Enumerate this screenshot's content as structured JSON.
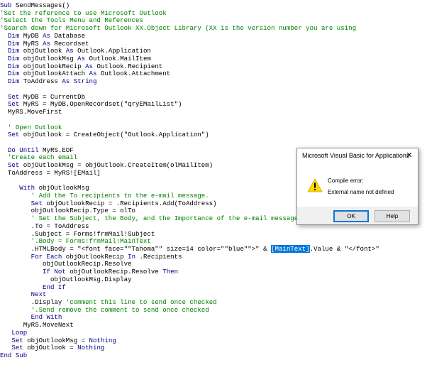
{
  "code": {
    "lines": [
      [
        {
          "k": "k",
          "t": "Sub "
        },
        {
          "k": "n",
          "t": "SendMessages()"
        }
      ],
      [
        {
          "k": "c",
          "t": "'Set the reference to use Microsoft Outlook"
        }
      ],
      [
        {
          "k": "c",
          "t": "'Select the Tools Menu and References"
        }
      ],
      [
        {
          "k": "c",
          "t": "'Search down for Microsoft Outlook XX.Object Library (XX is the version number you are using"
        }
      ],
      [
        {
          "k": "n",
          "t": "  "
        },
        {
          "k": "k",
          "t": "Dim "
        },
        {
          "k": "n",
          "t": "MyDB "
        },
        {
          "k": "k",
          "t": "As "
        },
        {
          "k": "n",
          "t": "Database"
        }
      ],
      [
        {
          "k": "n",
          "t": "  "
        },
        {
          "k": "k",
          "t": "Dim "
        },
        {
          "k": "n",
          "t": "MyRS "
        },
        {
          "k": "k",
          "t": "As "
        },
        {
          "k": "n",
          "t": "Recordset"
        }
      ],
      [
        {
          "k": "n",
          "t": "  "
        },
        {
          "k": "k",
          "t": "Dim "
        },
        {
          "k": "n",
          "t": "objOutlook "
        },
        {
          "k": "k",
          "t": "As "
        },
        {
          "k": "n",
          "t": "Outlook.Application"
        }
      ],
      [
        {
          "k": "n",
          "t": "  "
        },
        {
          "k": "k",
          "t": "Dim "
        },
        {
          "k": "n",
          "t": "objOutlookMsg "
        },
        {
          "k": "k",
          "t": "As "
        },
        {
          "k": "n",
          "t": "Outlook.MailItem"
        }
      ],
      [
        {
          "k": "n",
          "t": "  "
        },
        {
          "k": "k",
          "t": "Dim "
        },
        {
          "k": "n",
          "t": "objOutlookRecip "
        },
        {
          "k": "k",
          "t": "As "
        },
        {
          "k": "n",
          "t": "Outlook.Recipient"
        }
      ],
      [
        {
          "k": "n",
          "t": "  "
        },
        {
          "k": "k",
          "t": "Dim "
        },
        {
          "k": "n",
          "t": "objOutlookAttach "
        },
        {
          "k": "k",
          "t": "As "
        },
        {
          "k": "n",
          "t": "Outlook.Attachment"
        }
      ],
      [
        {
          "k": "n",
          "t": "  "
        },
        {
          "k": "k",
          "t": "Dim "
        },
        {
          "k": "n",
          "t": "ToAddress "
        },
        {
          "k": "k",
          "t": "As String"
        }
      ],
      [],
      [
        {
          "k": "n",
          "t": "  "
        },
        {
          "k": "k",
          "t": "Set "
        },
        {
          "k": "n",
          "t": "MyDB = CurrentDb"
        }
      ],
      [
        {
          "k": "n",
          "t": "  "
        },
        {
          "k": "k",
          "t": "Set "
        },
        {
          "k": "n",
          "t": "MyRS = MyDB.OpenRecordset(\"qryEMailList\")"
        }
      ],
      [
        {
          "k": "n",
          "t": "  MyRS.MoveFirst"
        }
      ],
      [],
      [
        {
          "k": "c",
          "t": "  ' Open Outlook"
        }
      ],
      [
        {
          "k": "n",
          "t": "  "
        },
        {
          "k": "k",
          "t": "Set "
        },
        {
          "k": "n",
          "t": "objOutlook = CreateObject(\"Outlook.Application\")"
        }
      ],
      [],
      [
        {
          "k": "n",
          "t": "  "
        },
        {
          "k": "k",
          "t": "Do Until "
        },
        {
          "k": "n",
          "t": "MyRS.EOF"
        }
      ],
      [
        {
          "k": "c",
          "t": "  'Create each email"
        }
      ],
      [
        {
          "k": "n",
          "t": "  "
        },
        {
          "k": "k",
          "t": "Set "
        },
        {
          "k": "n",
          "t": "objOutlookMsg = objOutlook.CreateItem(olMailItem)"
        }
      ],
      [
        {
          "k": "n",
          "t": "  ToAddress = MyRS![EMail]"
        }
      ],
      [],
      [
        {
          "k": "n",
          "t": "     "
        },
        {
          "k": "k",
          "t": "With "
        },
        {
          "k": "n",
          "t": "objOutlookMsg"
        }
      ],
      [
        {
          "k": "c",
          "t": "        ' Add the To recipients to the e-mail message."
        }
      ],
      [
        {
          "k": "n",
          "t": "        "
        },
        {
          "k": "k",
          "t": "Set "
        },
        {
          "k": "n",
          "t": "objOutlookRecip = .Recipients.Add(ToAddress)"
        }
      ],
      [
        {
          "k": "n",
          "t": "        objOutlookRecip.Type = olTo"
        }
      ],
      [
        {
          "k": "c",
          "t": "        ' Set the Subject, the Body, and the Importance of the e-mail message."
        }
      ],
      [
        {
          "k": "n",
          "t": "        .To = ToAddress"
        }
      ],
      [
        {
          "k": "n",
          "t": "        .Subject = Forms!frmMail!Subject"
        }
      ],
      [
        {
          "k": "c",
          "t": "        '.Body = Forms!frmMail!MainText"
        }
      ],
      [
        {
          "k": "n",
          "t": "        .HTMLBody = \"<font face=\"\"Tahoma\"\" size=14 color=\"\"blue\"\">\" & "
        },
        {
          "k": "h",
          "t": "[MainText]"
        },
        {
          "k": "n",
          "t": ".Value & \"</font>\""
        }
      ],
      [
        {
          "k": "n",
          "t": "        "
        },
        {
          "k": "k",
          "t": "For Each "
        },
        {
          "k": "n",
          "t": "objOutlookRecip "
        },
        {
          "k": "k",
          "t": "In "
        },
        {
          "k": "n",
          "t": ".Recipients"
        }
      ],
      [
        {
          "k": "n",
          "t": "           objOutlookRecip.Resolve"
        }
      ],
      [
        {
          "k": "n",
          "t": "           "
        },
        {
          "k": "k",
          "t": "If Not "
        },
        {
          "k": "n",
          "t": "objOutlookRecip.Resolve "
        },
        {
          "k": "k",
          "t": "Then"
        }
      ],
      [
        {
          "k": "n",
          "t": "             objOutlookMsg.Display"
        }
      ],
      [
        {
          "k": "n",
          "t": "           "
        },
        {
          "k": "k",
          "t": "End If"
        }
      ],
      [
        {
          "k": "n",
          "t": "        "
        },
        {
          "k": "k",
          "t": "Next"
        }
      ],
      [
        {
          "k": "n",
          "t": "        .Display "
        },
        {
          "k": "c",
          "t": "'comment this line to send once checked"
        }
      ],
      [
        {
          "k": "c",
          "t": "        '.Send remove the comment to send once checked"
        }
      ],
      [
        {
          "k": "n",
          "t": "        "
        },
        {
          "k": "k",
          "t": "End With"
        }
      ],
      [
        {
          "k": "n",
          "t": "      MyRS.MoveNext"
        }
      ],
      [
        {
          "k": "n",
          "t": "   "
        },
        {
          "k": "k",
          "t": "Loop"
        }
      ],
      [
        {
          "k": "n",
          "t": "   "
        },
        {
          "k": "k",
          "t": "Set "
        },
        {
          "k": "n",
          "t": "objOutlookMsg = "
        },
        {
          "k": "k",
          "t": "Nothing"
        }
      ],
      [
        {
          "k": "n",
          "t": "   "
        },
        {
          "k": "k",
          "t": "Set "
        },
        {
          "k": "n",
          "t": "objOutlook = "
        },
        {
          "k": "k",
          "t": "Nothing"
        }
      ],
      [
        {
          "k": "k",
          "t": "End Sub"
        }
      ]
    ]
  },
  "dialog": {
    "title": "Microsoft Visual Basic for Applications",
    "close_glyph": "✕",
    "icon": "warning-icon",
    "message_title": "Compile error:",
    "message_detail": "External name not defined",
    "ok_label": "OK",
    "help_label": "Help"
  },
  "colors": {
    "keyword": "#00008b",
    "comment": "#008000",
    "selection": "#0078d7",
    "warning_fill": "#ffd800"
  }
}
